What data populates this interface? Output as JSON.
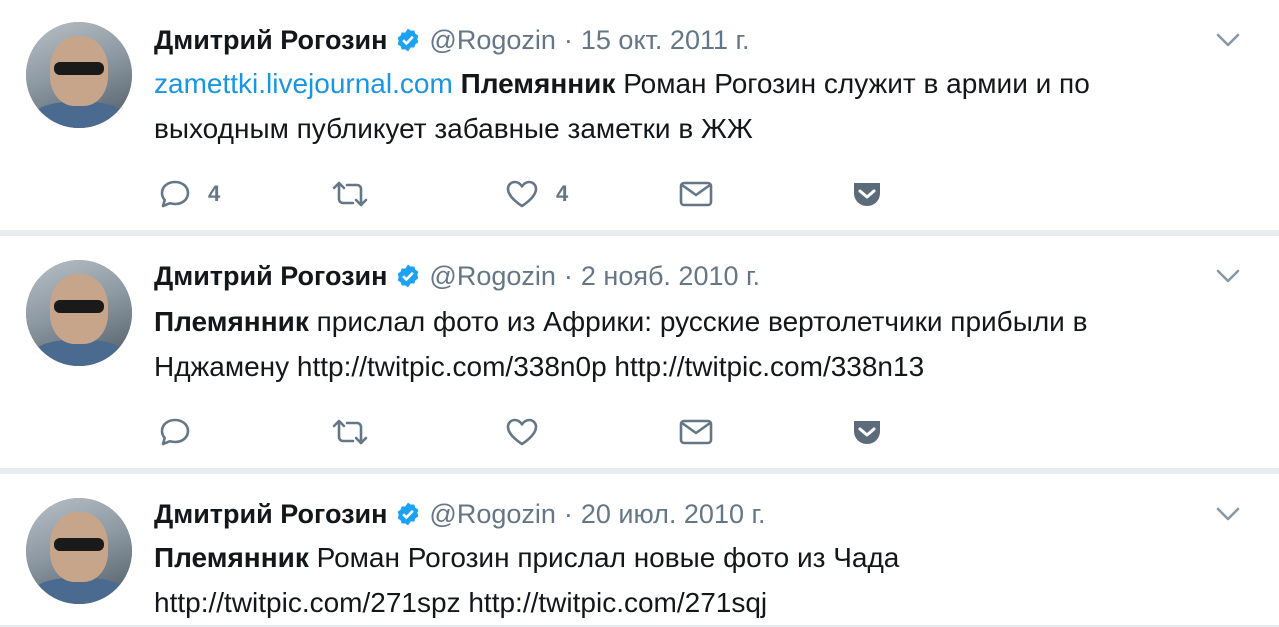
{
  "tweets": [
    {
      "name": "Дмитрий Рогозин",
      "handle": "@Rogozin",
      "separator": "·",
      "date": "15 окт. 2011 г.",
      "text_link": "zamettki.livejournal.com",
      "text_bold": "Племянник",
      "text_rest": " Роман Рогозин служит в армии и по",
      "text_line2": "выходным публикует забавные заметки в ЖЖ",
      "reply_count": "4",
      "retweet_count": "",
      "like_count": "4"
    },
    {
      "name": "Дмитрий Рогозин",
      "handle": "@Rogozin",
      "separator": "·",
      "date": "2 нояб. 2010 г.",
      "text_bold": "Племянник",
      "text_rest": " прислал фото из Африки: русские вертолетчики прибыли в",
      "text_line2": "Нджамену http://twitpic.com/338n0p http://twitpic.com/338n13",
      "reply_count": "",
      "retweet_count": "",
      "like_count": ""
    },
    {
      "name": "Дмитрий Рогозин",
      "handle": "@Rogozin",
      "separator": "·",
      "date": "20 июл. 2010 г.",
      "text_bold": "Племянник",
      "text_rest": " Роман Рогозин прислал новые фото из Чада",
      "text_line2": "http://twitpic.com/271spz http://twitpic.com/271sqj"
    }
  ],
  "colors": {
    "link": "#1b95e0",
    "secondary_text": "#657786",
    "verified": "#1da1f2",
    "background": "#e9ecef"
  },
  "icons": [
    "reply-icon",
    "retweet-icon",
    "like-icon",
    "dm-icon",
    "pocket-save-icon",
    "chevron-down-icon",
    "verified-badge-icon"
  ]
}
